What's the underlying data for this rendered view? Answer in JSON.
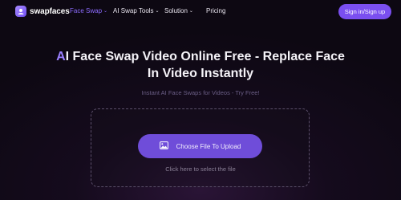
{
  "brand": {
    "name": "swapfaces"
  },
  "nav": {
    "items": [
      {
        "label": "Face Swap",
        "has_dropdown": true,
        "active": true
      },
      {
        "label": "AI Swap Tools",
        "has_dropdown": true,
        "active": false
      },
      {
        "label": "Solution",
        "has_dropdown": true,
        "active": false
      },
      {
        "label": "Pricing",
        "has_dropdown": false,
        "active": false
      }
    ],
    "signin_label": "Sign in/Sign up"
  },
  "hero": {
    "headline_accent": "A",
    "headline_line1_rest": "I Face Swap Video Online Free - Replace Face",
    "headline_line2": "In Video Instantly",
    "subtitle": "Instant AI Face Swaps for Videos - Try Free!"
  },
  "upload": {
    "button_label": "Choose File To Upload",
    "hint": "Click here to select the file",
    "button_icon": "image-icon"
  },
  "colors": {
    "accent": "#7a4ff0",
    "accent_text": "#9b80ff",
    "background": "#150b1d"
  }
}
